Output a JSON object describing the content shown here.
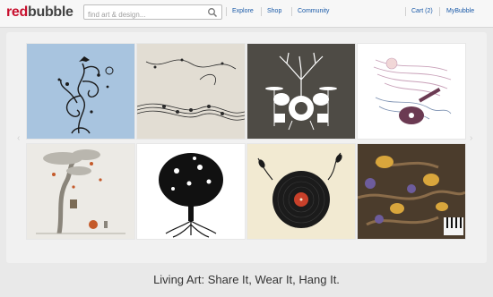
{
  "header": {
    "logo_part1": "red",
    "logo_part2": "bubble",
    "search_placeholder": "find art & design...",
    "nav": [
      "Explore",
      "Shop",
      "Community"
    ],
    "cart": "Cart (2)",
    "account": "MyBubble"
  },
  "gallery": {
    "prev_label": "‹",
    "next_label": "›",
    "tiles": [
      {
        "subject": "vine-tree-with-bird",
        "bg": "#a8c4df"
      },
      {
        "subject": "music-notes-swirl",
        "bg": "#e2ddd3"
      },
      {
        "subject": "drum-kit-tree",
        "bg": "#4e4b45"
      },
      {
        "subject": "guitar-girl-hair",
        "bg": "#ffffff"
      },
      {
        "subject": "whimsical-tree-house",
        "bg": "#eceae5"
      },
      {
        "subject": "music-instrument-tree",
        "bg": "#ffffff"
      },
      {
        "subject": "vinyl-record-vine",
        "bg": "#f2ead2"
      },
      {
        "subject": "guitars-forest-roots",
        "bg": "#4b3c2c"
      }
    ]
  },
  "tagline": "Living Art: Share It, Wear It, Hang It.",
  "colors": {
    "brand_red": "#c8102e",
    "link_blue": "#1a5aa8"
  }
}
